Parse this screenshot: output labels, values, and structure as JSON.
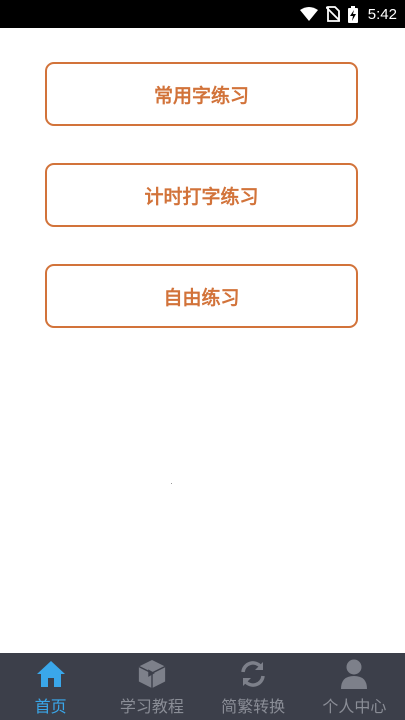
{
  "status_bar": {
    "time": "5:42",
    "icons": [
      "wifi-icon",
      "no-sim-icon",
      "battery-charging-icon"
    ]
  },
  "menu": {
    "items": [
      {
        "label": "常用字练习"
      },
      {
        "label": "计时打字练习"
      },
      {
        "label": "自由练习"
      }
    ]
  },
  "tab_bar": {
    "tabs": [
      {
        "label": "首页",
        "icon": "home-icon",
        "active": true
      },
      {
        "label": "学习教程",
        "icon": "tutorial-box-icon",
        "active": false
      },
      {
        "label": "简繁转换",
        "icon": "refresh-icon",
        "active": false
      },
      {
        "label": "个人中心",
        "icon": "user-icon",
        "active": false
      }
    ]
  },
  "colors": {
    "accent": "#d2733a",
    "tab_active": "#3aa7ea",
    "tab_inactive": "#8a8d96",
    "tab_bar_bg": "#3c3f4a"
  }
}
